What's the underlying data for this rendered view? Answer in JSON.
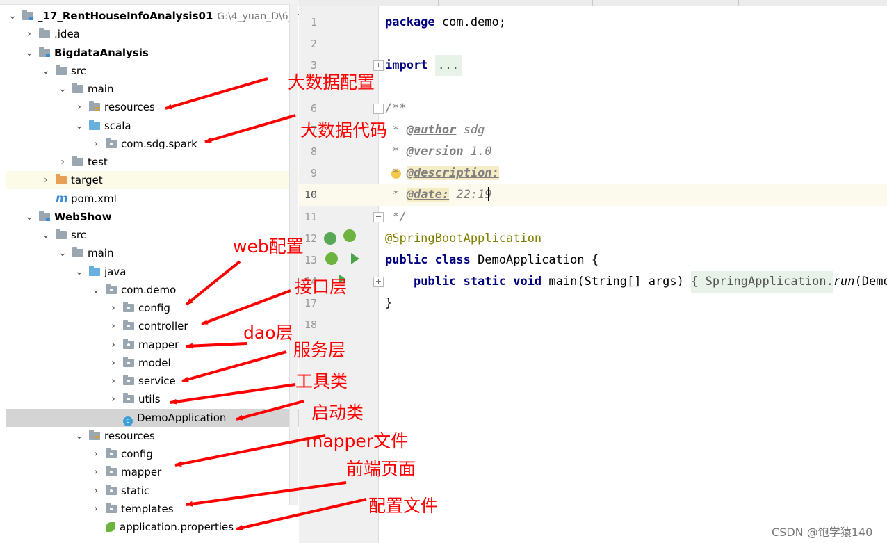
{
  "project": {
    "root": {
      "name": "_17_RentHouseInfoAnalysis01",
      "path": "G:\\4_yuan_D\\6_idea"
    },
    "items": [
      {
        "label": ".idea"
      },
      {
        "label": "BigdataAnalysis"
      },
      {
        "label": "src"
      },
      {
        "label": "main"
      },
      {
        "label": "resources"
      },
      {
        "label": "scala"
      },
      {
        "label": "com.sdg.spark"
      },
      {
        "label": "test"
      },
      {
        "label": "target"
      },
      {
        "label": "pom.xml"
      },
      {
        "label": "WebShow"
      },
      {
        "label": "src"
      },
      {
        "label": "main"
      },
      {
        "label": "java"
      },
      {
        "label": "com.demo"
      },
      {
        "label": "config"
      },
      {
        "label": "controller"
      },
      {
        "label": "mapper"
      },
      {
        "label": "model"
      },
      {
        "label": "service"
      },
      {
        "label": "utils"
      },
      {
        "label": "DemoApplication"
      },
      {
        "label": "resources"
      },
      {
        "label": "config"
      },
      {
        "label": "mapper"
      },
      {
        "label": "static"
      },
      {
        "label": "templates"
      },
      {
        "label": "application.properties"
      }
    ]
  },
  "editor": {
    "line_numbers": [
      "1",
      "2",
      "3",
      "6",
      "7",
      "8",
      "9",
      "10",
      "11",
      "12",
      "13",
      "14",
      "17",
      "18"
    ],
    "code": {
      "package_kw": "package",
      "package_name": " com.demo;",
      "import_kw": "import",
      "import_fold": "...",
      "doc_open": "/**",
      "author_prefix": " * ",
      "author_tag": "@author",
      "author_val": " sdg",
      "version_prefix": " * ",
      "version_tag": "@version",
      "version_val": " 1.0",
      "desc_prefix": " * ",
      "desc_tag": "@description:",
      "date_prefix": " * ",
      "date_tag": "@date:",
      "date_val": " 22:19",
      "doc_close": " */",
      "annotation": "@SpringBootApplication",
      "class_kw": "public class",
      "class_name": " DemoApplication {",
      "main_kw": "    public static void",
      "main_sig": " main(String[] args) ",
      "main_body": "{ SpringApplication.",
      "main_run": "run",
      "main_tail": "(Demo",
      "close_brace": "}"
    }
  },
  "annotations": [
    "大数据配置",
    "大数据代码",
    "web配置",
    "接口层",
    "dao层",
    "服务层",
    "工具类",
    "启动类",
    "mapper文件",
    "前端页面",
    "配置文件"
  ],
  "watermark": "CSDN @饱学猿140",
  "colors": {
    "annotation": "#ff0000",
    "selection": "#d4d4d4",
    "keyword": "#000080"
  }
}
